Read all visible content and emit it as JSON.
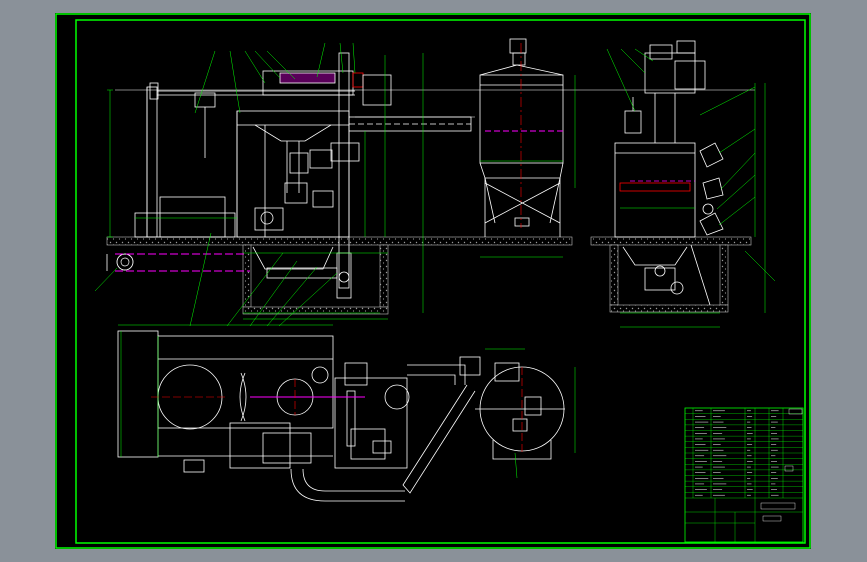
{
  "window": {
    "background": "#8a9199"
  },
  "sheet": {
    "background": "#000000",
    "colors": {
      "frame": "#00ff00",
      "outline": "#ffffff",
      "dimension": "#00ff00",
      "centerline": "#ff0000",
      "hidden": "#ff00ff",
      "ground": "#7f7f7f",
      "leader": "#00ff00"
    }
  },
  "title_block": {
    "drawing_name": "",
    "parts_rows": 16
  }
}
